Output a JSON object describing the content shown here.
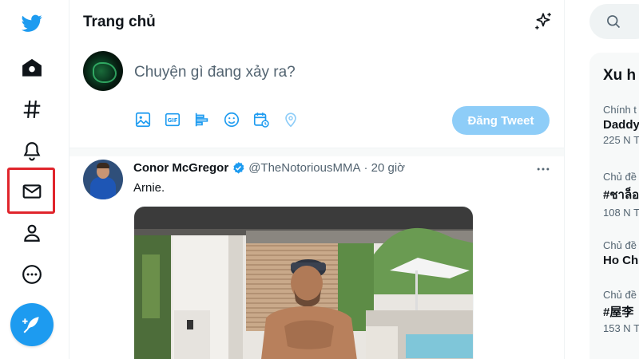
{
  "header": {
    "title": "Trang chủ"
  },
  "composer": {
    "placeholder": "Chuyện gì đang xảy ra?",
    "tweet_button": "Đăng Tweet"
  },
  "tweet": {
    "name": "Conor McGregor",
    "handle": "@TheNotoriousMMA",
    "time": "· 20 giờ",
    "text": "Arnie."
  },
  "trends": {
    "title": "Xu h",
    "items": [
      {
        "category": "Chính t",
        "name": "Daddy",
        "count": "225 N T"
      },
      {
        "category": "Chủ đề",
        "name": "#ชาล็อ",
        "count": "108 N T"
      },
      {
        "category": "Chủ đề",
        "name": "Ho Ch",
        "count": ""
      },
      {
        "category": "Chủ đề",
        "name": "#屋李",
        "count": "153 N T"
      }
    ]
  },
  "colors": {
    "accent": "#1d9bf0",
    "highlight": "#e0252c"
  }
}
